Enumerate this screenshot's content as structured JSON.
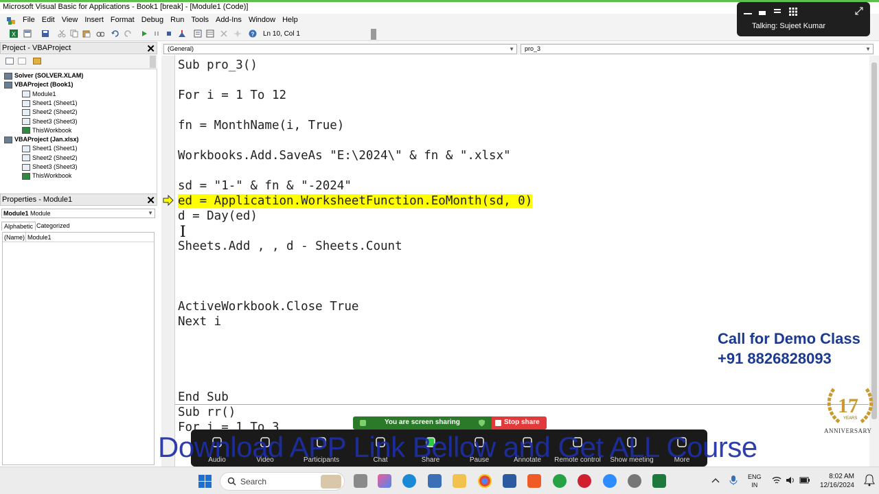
{
  "window": {
    "title": "Microsoft Visual Basic for Applications - Book1 [break] - [Module1 (Code)]"
  },
  "menu": [
    "File",
    "Edit",
    "View",
    "Insert",
    "Format",
    "Debug",
    "Run",
    "Tools",
    "Add-Ins",
    "Window",
    "Help"
  ],
  "toolbar": {
    "position": "Ln 10, Col 1"
  },
  "meeting_top": {
    "talking": "Talking: Sujeet Kumar"
  },
  "project": {
    "title": "Project - VBAProject",
    "tree": [
      {
        "label": "Solver (SOLVER.XLAM)",
        "level": 0,
        "bold": true
      },
      {
        "label": "VBAProject (Book1)",
        "level": 0,
        "bold": true
      },
      {
        "label": "Module1",
        "level": 1
      },
      {
        "label": "Sheet1 (Sheet1)",
        "level": 1
      },
      {
        "label": "Sheet2 (Sheet2)",
        "level": 1
      },
      {
        "label": "Sheet3 (Sheet3)",
        "level": 1
      },
      {
        "label": "ThisWorkbook",
        "level": 1
      },
      {
        "label": "VBAProject (Jan.xlsx)",
        "level": 0,
        "bold": true
      },
      {
        "label": "Sheet1 (Sheet1)",
        "level": 1
      },
      {
        "label": "Sheet2 (Sheet2)",
        "level": 1
      },
      {
        "label": "Sheet3 (Sheet3)",
        "level": 1
      },
      {
        "label": "ThisWorkbook",
        "level": 1
      }
    ]
  },
  "properties": {
    "title": "Properties - Module1",
    "object_name": "Module1",
    "object_type": "Module",
    "tabs": [
      "Alphabetic",
      "Categorized"
    ],
    "row_name": "(Name)",
    "row_value": "Module1"
  },
  "code": {
    "object_combo": "(General)",
    "proc_combo": "pro_3",
    "lines": [
      {
        "text": "Sub pro_3()"
      },
      {
        "text": "For i = 1 To 12"
      },
      {
        "text": "fn = MonthName(i, True)"
      },
      {
        "text": "Workbooks.Add.SaveAs \"E:\\2024\\\" & fn & \".xlsx\""
      },
      {
        "text": "sd = \"1-\" & fn & \"-2024\""
      },
      {
        "text": "ed = Application.WorksheetFunction.EoMonth(sd, 0)",
        "highlight": true
      },
      {
        "text": "d = Day(ed)"
      },
      {
        "text": "Sheets.Add , , d - Sheets.Count"
      },
      {
        "text": "ActiveWorkbook.Close True"
      },
      {
        "text": "Next i"
      },
      {
        "text": "End Sub"
      },
      {
        "text": "Sub rr()"
      },
      {
        "text": "For i = 1 To 3"
      }
    ]
  },
  "promo": {
    "line1": "Call for Demo Class",
    "line2": "+91 8826828093",
    "badge_number": "17",
    "badge_years": "YEARS",
    "badge_text": "ANNIVERSARY"
  },
  "share": {
    "status": "You are screen sharing",
    "stop": "Stop share"
  },
  "meeting_bar": {
    "buttons": [
      "Audio",
      "Video",
      "Participants",
      "Chat",
      "Share",
      "Pause",
      "Annotate",
      "Remote control",
      "Show meeting",
      "More"
    ]
  },
  "banner": "Download APP Link Bellow and Get ALL Course",
  "taskbar": {
    "search": "Search",
    "lang1": "ENG",
    "lang2": "IN",
    "time": "8:02 AM",
    "date": "12/16/2024"
  }
}
